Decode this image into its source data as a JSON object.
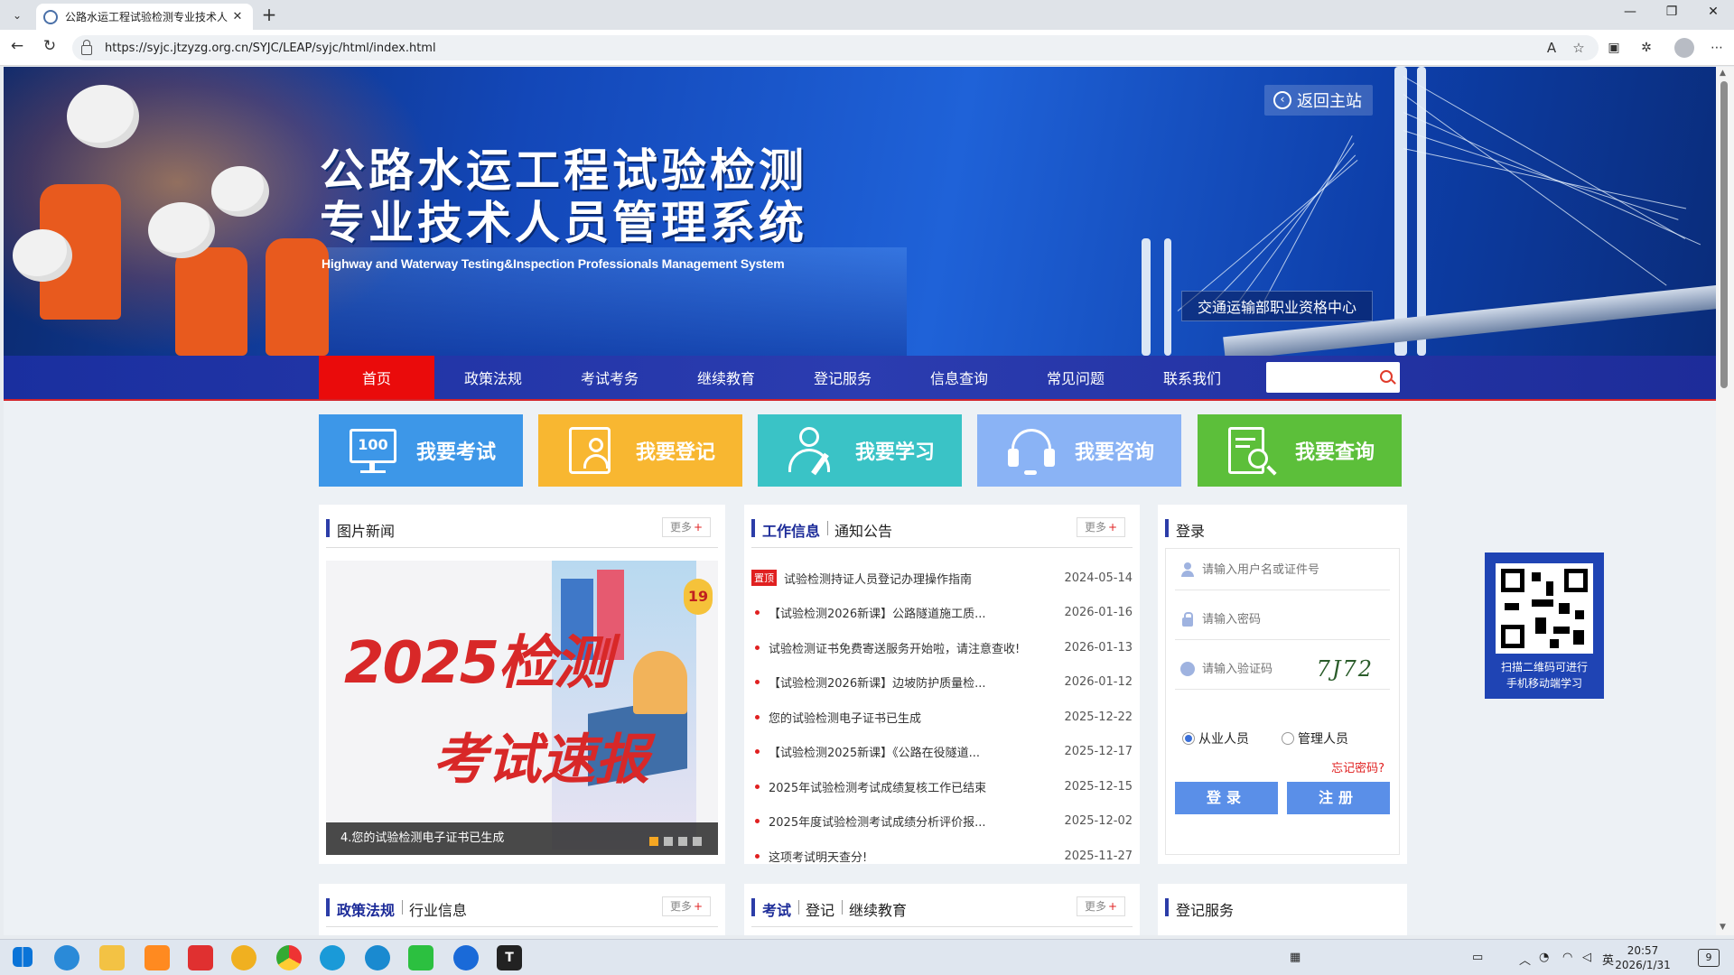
{
  "browser": {
    "tab_title": "公路水运工程试验检测专业技术人",
    "url": "https://syjc.jtzyzg.org.cn/SYJC/LEAP/syjc/html/index.html"
  },
  "banner": {
    "title_line1": "公路水运工程试验检测",
    "title_line2": "专业技术人员管理系统",
    "subtitle": "Highway and Waterway Testing&Inspection Professionals Management System",
    "back_label": "返回主站",
    "center_label": "交通运输部职业资格中心"
  },
  "nav": {
    "items": [
      "首页",
      "政策法规",
      "考试考务",
      "继续教育",
      "登记服务",
      "信息查询",
      "常见问题",
      "联系我们"
    ],
    "search_placeholder": ""
  },
  "quick": {
    "items": [
      {
        "label": "我要考试",
        "color": "#3d97e8",
        "icon": "exam-icon",
        "icon_text": "100"
      },
      {
        "label": "我要登记",
        "color": "#f8b731",
        "icon": "register-icon"
      },
      {
        "label": "我要学习",
        "color": "#3ac3c6",
        "icon": "study-icon"
      },
      {
        "label": "我要咨询",
        "color": "#8ab3f5",
        "icon": "consult-icon"
      },
      {
        "label": "我要查询",
        "color": "#5cbf3a",
        "icon": "query-icon"
      }
    ]
  },
  "photo_news": {
    "title": "图片新闻",
    "more": "更多",
    "image_title1": "2025检测",
    "image_title2": "考试速报",
    "image_badge": "19",
    "caption": "4.您的试验检测电子证书已生成"
  },
  "work": {
    "tab1": "工作信息",
    "tab2": "通知公告",
    "more": "更多",
    "top_tag": "置顶",
    "rows": [
      {
        "title": "试验检测持证人员登记办理操作指南",
        "date": "2024-05-14"
      },
      {
        "title": "【试验检测2026新课】公路隧道施工质...",
        "date": "2026-01-16"
      },
      {
        "title": "试验检测证书免费寄送服务开始啦，请注意查收!",
        "date": "2026-01-13"
      },
      {
        "title": "【试验检测2026新课】边坡防护质量检...",
        "date": "2026-01-12"
      },
      {
        "title": "您的试验检测电子证书已生成",
        "date": "2025-12-22"
      },
      {
        "title": "【试验检测2025新课】《公路在役隧道...",
        "date": "2025-12-17"
      },
      {
        "title": "2025年试验检测考试成绩复核工作已结束",
        "date": "2025-12-15"
      },
      {
        "title": "2025年度试验检测考试成绩分析评价报...",
        "date": "2025-12-02"
      },
      {
        "title": "这项考试明天查分!",
        "date": "2025-11-27"
      }
    ]
  },
  "login": {
    "title": "登录",
    "username_placeholder": "请输入用户名或证件号",
    "password_placeholder": "请输入密码",
    "captcha_placeholder": "请输入验证码",
    "captcha": "7J72",
    "role1": "从业人员",
    "role2": "管理人员",
    "forgot": "忘记密码?",
    "login_btn": "登录",
    "register_btn": "注册"
  },
  "qr": {
    "caption1": "扫描二维码可进行",
    "caption2": "手机移动端学习"
  },
  "bottom": {
    "policy_tab1": "政策法规",
    "policy_tab2": "行业信息",
    "exam_tab1": "考试",
    "exam_tab2": "登记",
    "exam_tab3": "继续教育",
    "reg_title": "登记服务",
    "more": "更多"
  },
  "taskbar": {
    "ime": "英",
    "time": "20:57",
    "date": "2026/1/31",
    "notif": "9"
  }
}
